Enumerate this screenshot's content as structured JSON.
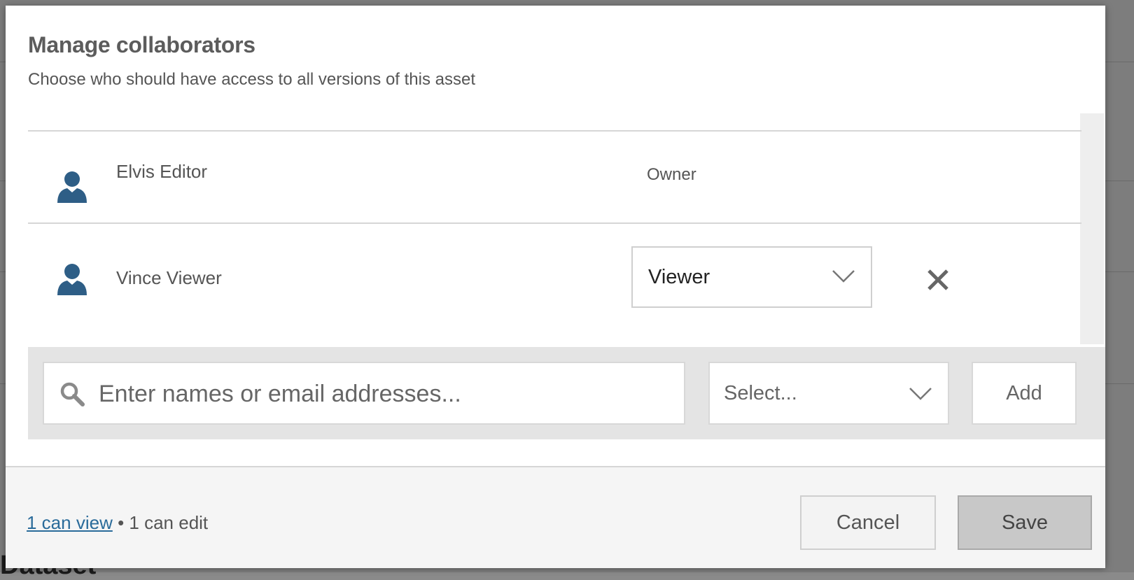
{
  "background": {
    "heading": "Dataset"
  },
  "dialog": {
    "title": "Manage collaborators",
    "subtitle": "Choose who should have access to all versions of this asset"
  },
  "collaborators": [
    {
      "name": "Elvis Editor",
      "role": "Owner",
      "icon": "person-icon"
    },
    {
      "name": "Vince Viewer",
      "role": "Viewer",
      "icon": "person-icon"
    }
  ],
  "add_bar": {
    "search_placeholder": "Enter names or email addresses...",
    "permission_placeholder": "Select...",
    "add_label": "Add"
  },
  "footer": {
    "view_count_link": "1 can view",
    "separator": " • ",
    "edit_count": "1 can edit",
    "cancel_label": "Cancel",
    "save_label": "Save"
  },
  "colors": {
    "avatar": "#2e5e86",
    "link": "#2a6b9a",
    "save_bg": "#c8c8c8"
  }
}
